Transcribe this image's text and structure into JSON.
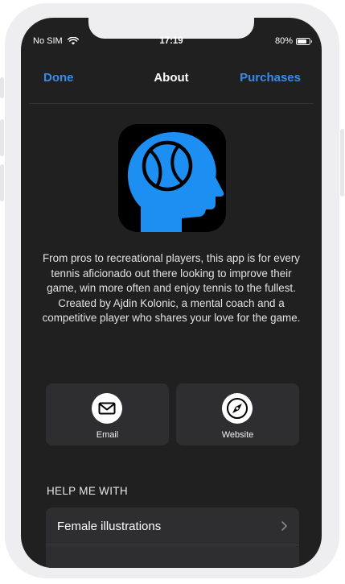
{
  "status_bar": {
    "carrier": "No SIM",
    "time": "17:19",
    "battery": "80%",
    "battery_level": 0.8
  },
  "nav": {
    "left_label": "Done",
    "title": "About",
    "right_label": "Purchases"
  },
  "app": {
    "icon": "tennis-head-icon",
    "description": "From pros to recreational players, this app is for every tennis aficionado out there looking to improve their game, win more often and enjoy tennis to the fullest. Created by Ajdin Kolonic, a mental coach and a competitive player who shares your love for the game."
  },
  "actions": [
    {
      "label": "Email",
      "icon": "envelope-icon"
    },
    {
      "label": "Website",
      "icon": "compass-icon"
    }
  ],
  "help_section": {
    "header": "HELP ME WITH",
    "items": [
      {
        "label": "Female illustrations",
        "icon": "chevron-right-icon"
      }
    ]
  },
  "colors": {
    "accent": "#3a8be8",
    "background": "#202021",
    "card": "#2e2e30",
    "icon_blue": "#1e8ff2"
  }
}
